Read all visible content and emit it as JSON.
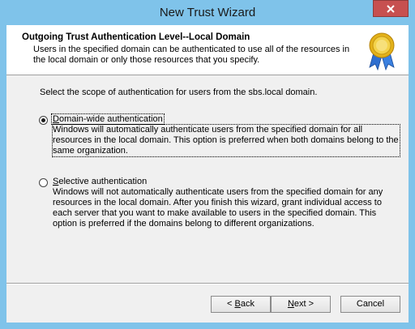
{
  "window": {
    "title": "New Trust Wizard"
  },
  "header": {
    "title": "Outgoing Trust Authentication Level--Local Domain",
    "description": "Users in the specified domain can be authenticated to use all of the resources in the local domain or only those resources that you specify."
  },
  "content": {
    "scope_text": "Select the scope of authentication for users from the sbs.local domain.",
    "options": [
      {
        "label_prefix": "",
        "label_mnemonic": "D",
        "label_rest": "omain-wide authentication",
        "selected": true,
        "description": "Windows will automatically authenticate users from the specified domain for all resources in the local domain. This option is preferred when both domains belong to the same organization."
      },
      {
        "label_prefix": "",
        "label_mnemonic": "S",
        "label_rest": "elective authentication",
        "selected": false,
        "description": "Windows will not automatically authenticate users from the specified domain for any resources in the local domain. After you finish this wizard, grant individual access to each server that you want to make available to users in the specified domain. This option is preferred if the domains belong to different organizations."
      }
    ]
  },
  "buttons": {
    "back_prefix": "< ",
    "back_mnemonic": "B",
    "back_rest": "ack",
    "next_mnemonic": "N",
    "next_rest": "ext >",
    "cancel": "Cancel"
  },
  "icons": {
    "close": "close-icon",
    "wizard_seal": "award-seal-icon"
  },
  "colors": {
    "titlebar": "#7fc3ea",
    "close_button": "#c75050",
    "dialog_bg": "#f0f0f0"
  }
}
